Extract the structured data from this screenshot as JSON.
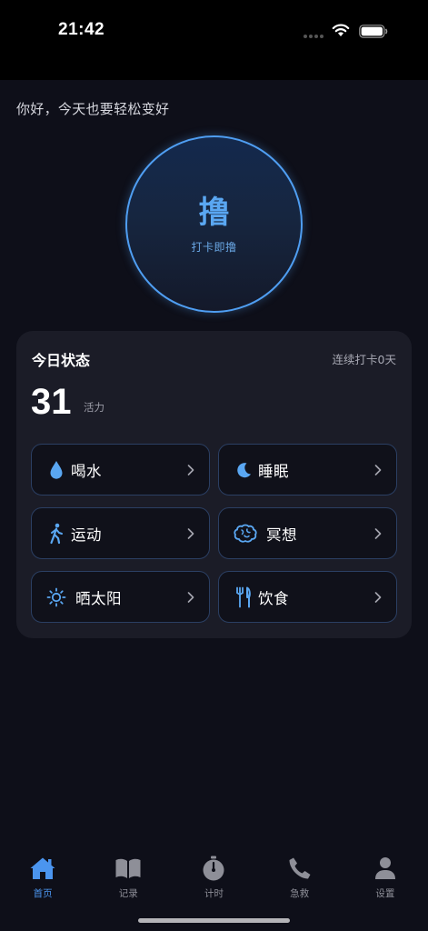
{
  "status_bar": {
    "time": "21:42",
    "icons": [
      "signal-dots-icon",
      "wifi-icon",
      "battery-icon"
    ]
  },
  "greeting": "你好，今天也要轻松变好",
  "checkin": {
    "main_char": "撸",
    "sub_label": "打卡即撸"
  },
  "today_card": {
    "title": "今日状态",
    "streak": "连续打卡0天",
    "vitality_value": "31",
    "vitality_label": "活力"
  },
  "activities": [
    {
      "label": "喝水",
      "icon": "water-drop-icon"
    },
    {
      "label": "睡眠",
      "icon": "moon-icon"
    },
    {
      "label": "运动",
      "icon": "walking-figure-icon"
    },
    {
      "label": "冥想",
      "icon": "brain-icon"
    },
    {
      "label": "晒太阳",
      "icon": "sun-icon"
    },
    {
      "label": "饮食",
      "icon": "fork-knife-icon"
    }
  ],
  "tabs": [
    {
      "label": "首页",
      "icon": "house-icon",
      "active": true
    },
    {
      "label": "记录",
      "icon": "book-icon",
      "active": false
    },
    {
      "label": "计时",
      "icon": "stopwatch-icon",
      "active": false
    },
    {
      "label": "急救",
      "icon": "phone-icon",
      "active": false
    },
    {
      "label": "设置",
      "icon": "person-icon",
      "active": false
    }
  ],
  "colors": {
    "background": "#0e0f19",
    "card": "#1b1c27",
    "accent": "#4b95ef",
    "tile_border": "#2b3f63"
  }
}
